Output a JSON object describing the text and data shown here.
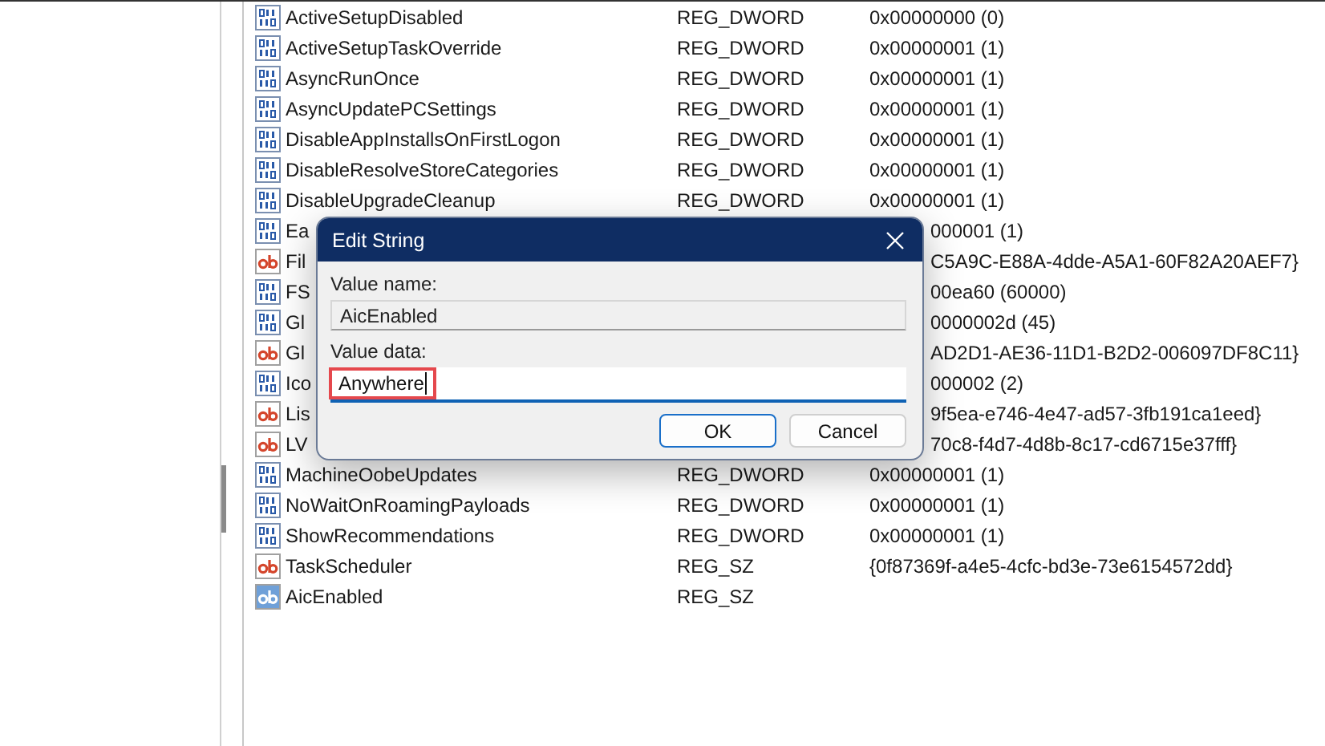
{
  "rows": [
    {
      "kind": "dword",
      "name": "ActiveSetupDisabled",
      "type": "REG_DWORD",
      "data": "0x00000000 (0)",
      "selected": false,
      "covered": false
    },
    {
      "kind": "dword",
      "name": "ActiveSetupTaskOverride",
      "type": "REG_DWORD",
      "data": "0x00000001 (1)",
      "selected": false,
      "covered": false
    },
    {
      "kind": "dword",
      "name": "AsyncRunOnce",
      "type": "REG_DWORD",
      "data": "0x00000001 (1)",
      "selected": false,
      "covered": false
    },
    {
      "kind": "dword",
      "name": "AsyncUpdatePCSettings",
      "type": "REG_DWORD",
      "data": "0x00000001 (1)",
      "selected": false,
      "covered": false
    },
    {
      "kind": "dword",
      "name": "DisableAppInstallsOnFirstLogon",
      "type": "REG_DWORD",
      "data": "0x00000001 (1)",
      "selected": false,
      "covered": false
    },
    {
      "kind": "dword",
      "name": "DisableResolveStoreCategories",
      "type": "REG_DWORD",
      "data": "0x00000001 (1)",
      "selected": false,
      "covered": false
    },
    {
      "kind": "dword",
      "name": "DisableUpgradeCleanup",
      "type": "REG_DWORD",
      "data": "0x00000001 (1)",
      "selected": false,
      "covered": false
    },
    {
      "kind": "dword",
      "name": "Ea",
      "data": "000001 (1)",
      "selected": false,
      "covered": true
    },
    {
      "kind": "string",
      "name": "Fil",
      "data": "C5A9C-E88A-4dde-A5A1-60F82A20AEF7}",
      "selected": false,
      "covered": true
    },
    {
      "kind": "dword",
      "name": "FS",
      "data": "00ea60 (60000)",
      "selected": false,
      "covered": true
    },
    {
      "kind": "dword",
      "name": "Gl",
      "data": "0000002d (45)",
      "selected": false,
      "covered": true
    },
    {
      "kind": "string",
      "name": "Gl",
      "data": "AD2D1-AE36-11D1-B2D2-006097DF8C11}",
      "selected": false,
      "covered": true
    },
    {
      "kind": "dword",
      "name": "Ico",
      "data": "000002 (2)",
      "selected": false,
      "covered": true
    },
    {
      "kind": "string",
      "name": "Lis",
      "data": "9f5ea-e746-4e47-ad57-3fb191ca1eed}",
      "selected": false,
      "covered": true
    },
    {
      "kind": "string",
      "name": "LV",
      "data": "70c8-f4d7-4d8b-8c17-cd6715e37fff}",
      "selected": false,
      "covered": true
    },
    {
      "kind": "dword",
      "name": "MachineOobeUpdates",
      "type": "REG_DWORD",
      "data": "0x00000001 (1)",
      "selected": false,
      "covered": false
    },
    {
      "kind": "dword",
      "name": "NoWaitOnRoamingPayloads",
      "type": "REG_DWORD",
      "data": "0x00000001 (1)",
      "selected": false,
      "covered": false
    },
    {
      "kind": "dword",
      "name": "ShowRecommendations",
      "type": "REG_DWORD",
      "data": "0x00000001 (1)",
      "selected": false,
      "covered": false
    },
    {
      "kind": "string",
      "name": "TaskScheduler",
      "type": "REG_SZ",
      "data": "{0f87369f-a4e5-4cfc-bd3e-73e6154572dd}",
      "selected": false,
      "covered": false
    },
    {
      "kind": "string",
      "name": "AicEnabled",
      "type": "REG_SZ",
      "selected": true,
      "covered": false
    }
  ],
  "dialog": {
    "title": "Edit String",
    "name_label": "Value name:",
    "name_value": "AicEnabled",
    "data_label": "Value data:",
    "data_value": "Anywhere",
    "buttons": [
      "OK",
      "Cancel"
    ]
  }
}
